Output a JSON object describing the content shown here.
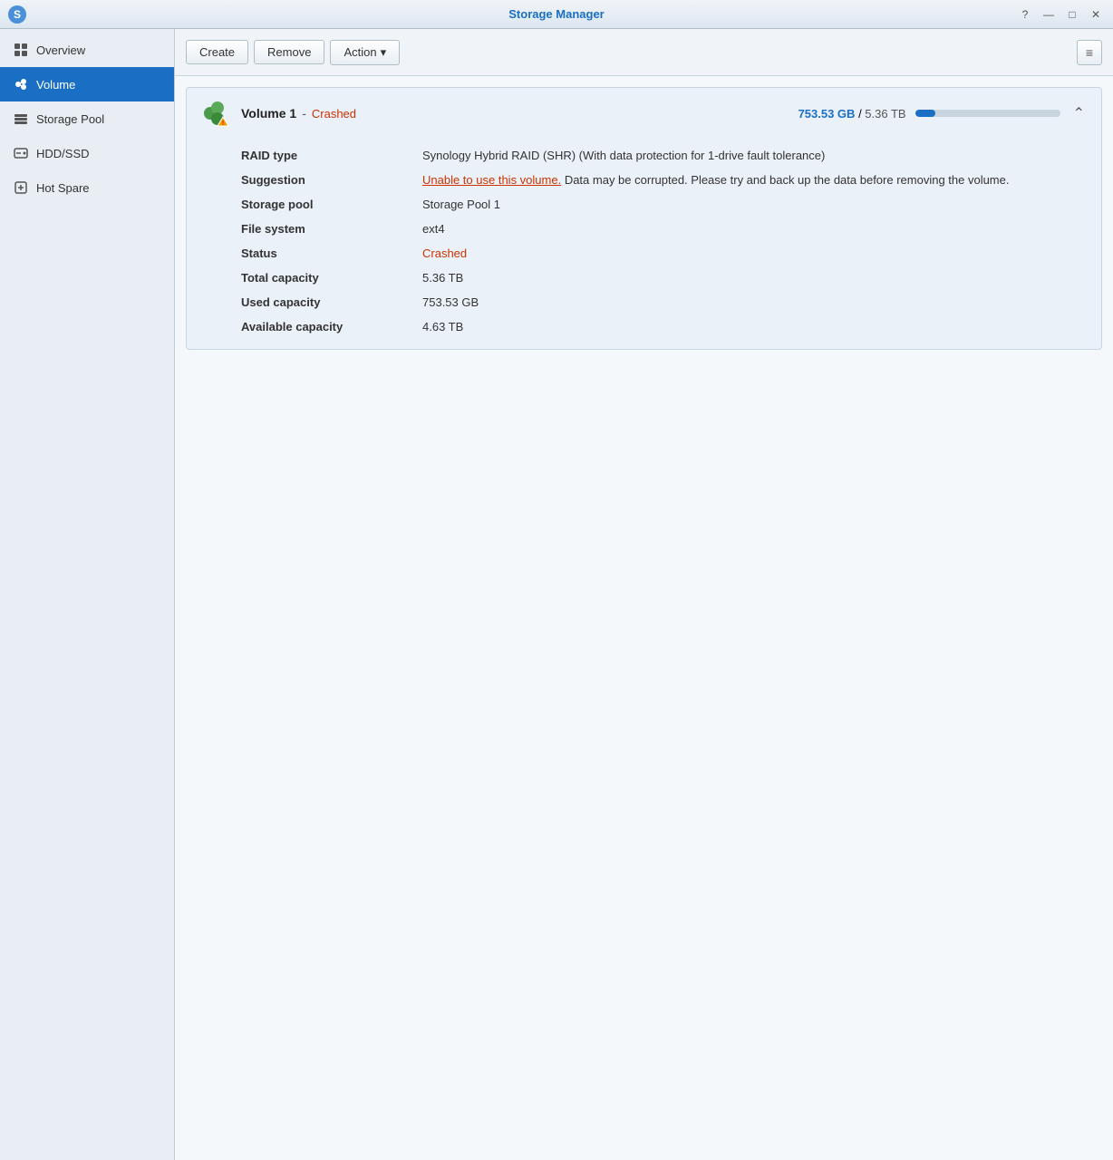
{
  "titleBar": {
    "title": "Storage Manager",
    "appIcon": "storage-manager-icon"
  },
  "titleControls": {
    "help": "?",
    "minimize": "—",
    "maximize": "□",
    "close": "✕"
  },
  "sidebar": {
    "items": [
      {
        "id": "overview",
        "label": "Overview",
        "icon": "overview-icon",
        "active": false
      },
      {
        "id": "volume",
        "label": "Volume",
        "icon": "volume-icon",
        "active": true
      },
      {
        "id": "storage-pool",
        "label": "Storage Pool",
        "icon": "storage-pool-icon",
        "active": false
      },
      {
        "id": "hdd-ssd",
        "label": "HDD/SSD",
        "icon": "hdd-icon",
        "active": false
      },
      {
        "id": "hot-spare",
        "label": "Hot Spare",
        "icon": "hot-spare-icon",
        "active": false
      }
    ]
  },
  "toolbar": {
    "createLabel": "Create",
    "removeLabel": "Remove",
    "actionLabel": "Action",
    "actionArrow": "▾",
    "viewToggleIcon": "≡"
  },
  "volumes": [
    {
      "id": "volume-1",
      "name": "Volume 1",
      "separator": "-",
      "status": "Crashed",
      "capacityUsed": "753.53 GB",
      "capacitySeparator": "/",
      "capacityTotal": "5.36 TB",
      "capacityPercent": 14,
      "details": {
        "raidTypeLabel": "RAID type",
        "raidTypeValue": "Synology Hybrid RAID (SHR) (With data protection for 1-drive fault tolerance)",
        "suggestionLabel": "Suggestion",
        "suggestionLinkText": "Unable to use this volume.",
        "suggestionRest": " Data may be corrupted. Please try and back up the data before removing the volume.",
        "storagePoolLabel": "Storage pool",
        "storagePoolValue": "Storage Pool 1",
        "fileSystemLabel": "File system",
        "fileSystemValue": "ext4",
        "statusLabel": "Status",
        "statusValue": "Crashed",
        "totalCapacityLabel": "Total capacity",
        "totalCapacityValue": "5.36 TB",
        "usedCapacityLabel": "Used capacity",
        "usedCapacityValue": "753.53 GB",
        "availableCapacityLabel": "Available capacity",
        "availableCapacityValue": "4.63 TB"
      }
    }
  ]
}
